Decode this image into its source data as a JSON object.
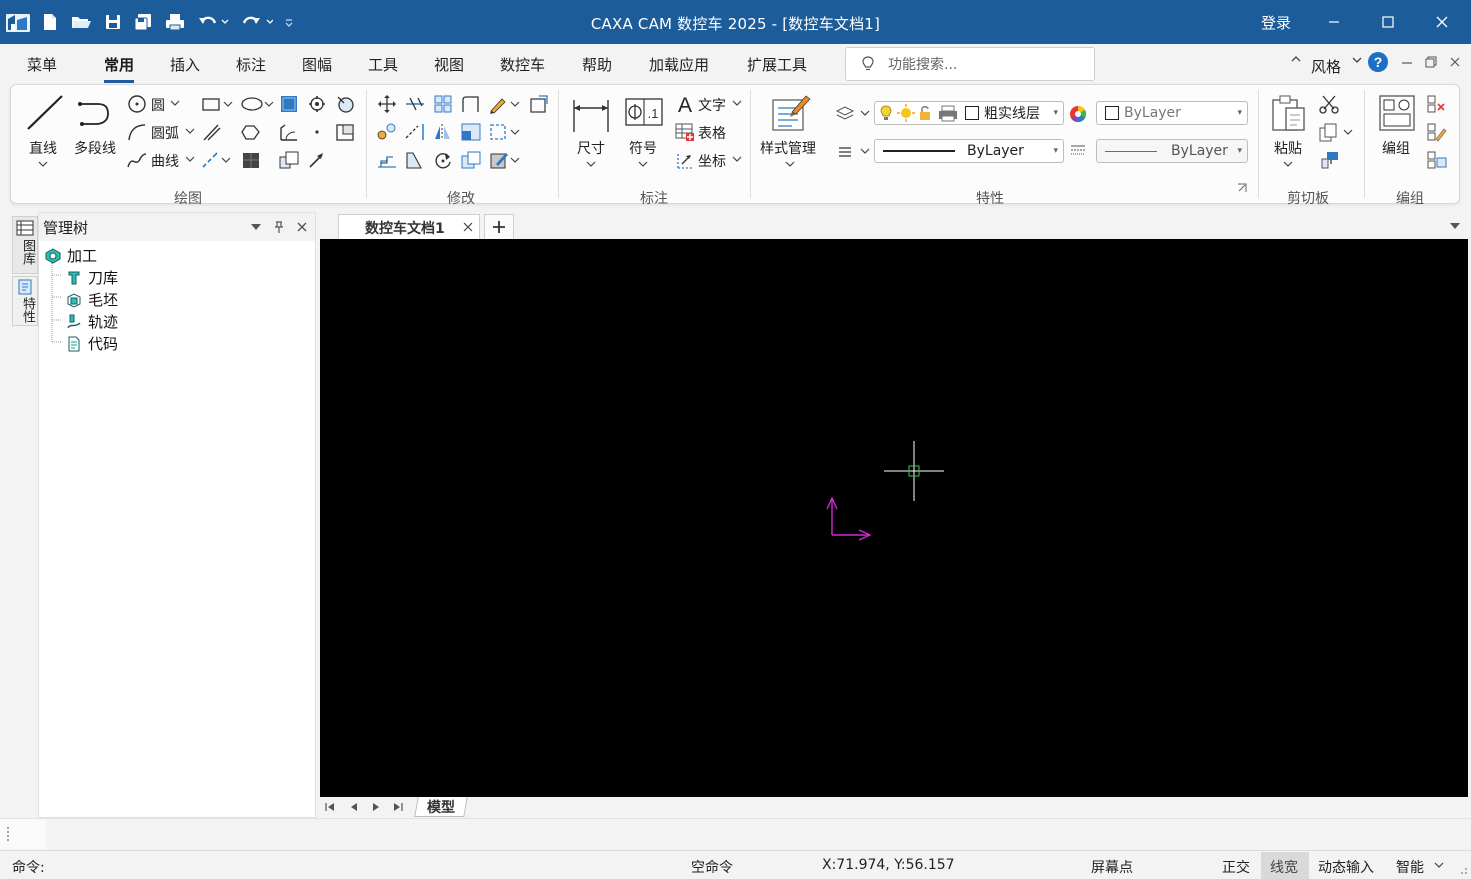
{
  "window": {
    "title": "CAXA CAM 数控车 2025 - [数控车文档1]",
    "login_label": "登录",
    "titlebar_color": "#1c5c9a"
  },
  "menu": {
    "items": [
      "菜单",
      "常用",
      "插入",
      "标注",
      "图幅",
      "工具",
      "视图",
      "数控车",
      "帮助",
      "加载应用",
      "扩展工具"
    ],
    "active": "常用",
    "style_label": "风格",
    "search_placeholder": "功能搜索..."
  },
  "ribbon": {
    "draw": {
      "group_label": "绘图",
      "line": "直线",
      "polyline": "多段线",
      "circle": "圆",
      "arc": "圆弧",
      "curve": "曲线"
    },
    "modify": {
      "group_label": "修改"
    },
    "annotate": {
      "group_label": "标注",
      "dimension": "尺寸",
      "symbol": "符号",
      "text": "文字",
      "table": "表格",
      "coordinate": "坐标"
    },
    "properties": {
      "group_label": "特性",
      "style_manager": "样式管理",
      "layer_name": "粗实线层",
      "color_value": "ByLayer",
      "linetype_value": "ByLayer",
      "lineweight_value": "ByLayer"
    },
    "clipboard": {
      "group_label": "剪切板",
      "paste": "粘贴"
    },
    "group": {
      "group_label": "编组",
      "group_btn": "编组"
    }
  },
  "side_tabs": [
    "图库",
    "特性"
  ],
  "tree_panel": {
    "title": "管理树",
    "root": "加工",
    "children": [
      "刀库",
      "毛坯",
      "轨迹",
      "代码"
    ]
  },
  "document_tab": "数控车文档1",
  "sheet_tab": "模型",
  "command": {
    "prompt": "命令:"
  },
  "status": {
    "command_state": "空命令",
    "coordinates": "X:71.974, Y:56.157",
    "snap_mode": "屏幕点",
    "ortho": "正交",
    "lineweight": "线宽",
    "dynamic_input": "动态输入",
    "smart": "智能"
  }
}
